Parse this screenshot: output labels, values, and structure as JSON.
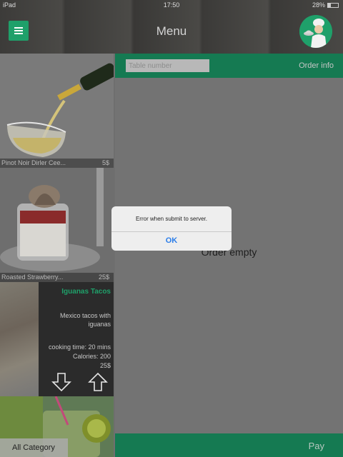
{
  "status_bar": {
    "device": "iPad",
    "time": "17:50",
    "battery": "28%",
    "battery_level": 0.28
  },
  "header": {
    "title": "Menu"
  },
  "menu": {
    "items": [
      {
        "name": "Pinot Noir Dirler Cee...",
        "price": "5$"
      },
      {
        "name": "Roasted Strawberry...",
        "price": "25$"
      }
    ],
    "featured": {
      "name": "Iguanas Tacos",
      "description_line1": "Mexico tacos with",
      "description_line2": "iguanas",
      "cooking_time": "cooking time: 20 mins",
      "calories": "Calories: 200",
      "price": "25$"
    },
    "all_category_label": "All Category"
  },
  "order": {
    "table_placeholder": "Table number",
    "order_info_label": "Order info",
    "empty_text": "Order empty",
    "pay_label": "Pay"
  },
  "alert": {
    "message": "Error when submit to server.",
    "ok_label": "OK"
  },
  "colors": {
    "accent": "#1fa06a",
    "bar": "#157a52",
    "link": "#2b7de9"
  }
}
